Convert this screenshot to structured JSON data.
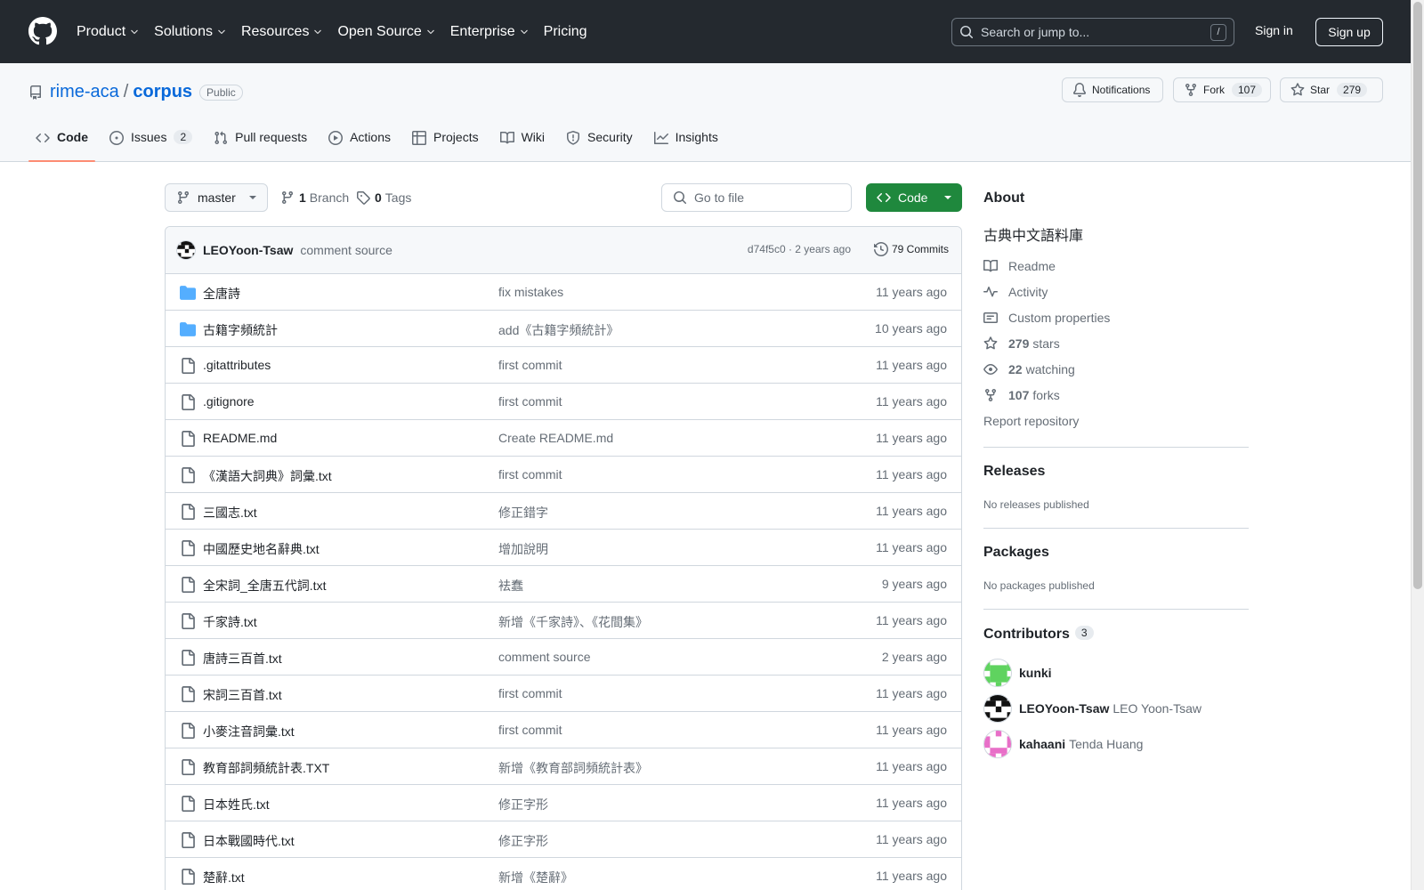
{
  "header": {
    "nav": [
      "Product",
      "Solutions",
      "Resources",
      "Open Source",
      "Enterprise",
      "Pricing"
    ],
    "search_placeholder": "Search or jump to...",
    "search_hint": "/",
    "signin": "Sign in",
    "signup": "Sign up"
  },
  "repo": {
    "owner": "rime-aca",
    "separator": "/",
    "name": "corpus",
    "visibility": "Public",
    "notifications": "Notifications",
    "fork_label": "Fork",
    "fork_count": "107",
    "star_label": "Star",
    "star_count": "279"
  },
  "tabs": [
    {
      "label": "Code",
      "icon": "code-icon"
    },
    {
      "label": "Issues",
      "icon": "issue-icon",
      "count": "2"
    },
    {
      "label": "Pull requests",
      "icon": "pull-request-icon"
    },
    {
      "label": "Actions",
      "icon": "play-icon"
    },
    {
      "label": "Projects",
      "icon": "table-icon"
    },
    {
      "label": "Wiki",
      "icon": "book-icon"
    },
    {
      "label": "Security",
      "icon": "shield-icon"
    },
    {
      "label": "Insights",
      "icon": "graph-icon"
    }
  ],
  "toolbar": {
    "branch": "master",
    "branch_count": "1",
    "branch_label": "Branch",
    "tag_count": "0",
    "tag_label": "Tags",
    "goto_placeholder": "Go to file",
    "code_button": "Code"
  },
  "latest_commit": {
    "author": "LEOYoon-Tsaw",
    "message": "comment source",
    "sha_age": "d74f5c0 · 2 years ago",
    "commits": "79 Commits"
  },
  "files": [
    {
      "type": "dir",
      "name": "全唐詩",
      "message": "fix mistakes",
      "age": "11 years ago"
    },
    {
      "type": "dir",
      "name": "古籍字頻統計",
      "message": "add《古籍字頻統計》",
      "age": "10 years ago"
    },
    {
      "type": "file",
      "name": ".gitattributes",
      "message": "first commit",
      "age": "11 years ago"
    },
    {
      "type": "file",
      "name": ".gitignore",
      "message": "first commit",
      "age": "11 years ago"
    },
    {
      "type": "file",
      "name": "README.md",
      "message": "Create README.md",
      "age": "11 years ago"
    },
    {
      "type": "file",
      "name": "《漢語大詞典》詞彙.txt",
      "message": "first commit",
      "age": "11 years ago"
    },
    {
      "type": "file",
      "name": "三國志.txt",
      "message": "修正錯字",
      "age": "11 years ago"
    },
    {
      "type": "file",
      "name": "中國歷史地名辭典.txt",
      "message": "增加說明",
      "age": "11 years ago"
    },
    {
      "type": "file",
      "name": "全宋詞_全唐五代詞.txt",
      "message": "袪蠢",
      "age": "9 years ago"
    },
    {
      "type": "file",
      "name": "千家詩.txt",
      "message": "新增《千家詩》、《花間集》",
      "age": "11 years ago"
    },
    {
      "type": "file",
      "name": "唐詩三百首.txt",
      "message": "comment source",
      "age": "2 years ago"
    },
    {
      "type": "file",
      "name": "宋詞三百首.txt",
      "message": "first commit",
      "age": "11 years ago"
    },
    {
      "type": "file",
      "name": "小麥注音詞彙.txt",
      "message": "first commit",
      "age": "11 years ago"
    },
    {
      "type": "file",
      "name": "教育部詞頻統計表.TXT",
      "message": "新增《教育部詞頻統計表》",
      "age": "11 years ago"
    },
    {
      "type": "file",
      "name": "日本姓氏.txt",
      "message": "修正字形",
      "age": "11 years ago"
    },
    {
      "type": "file",
      "name": "日本戰國時代.txt",
      "message": "修正字形",
      "age": "11 years ago"
    },
    {
      "type": "file",
      "name": "楚辭.txt",
      "message": "新增《楚辭》",
      "age": "11 years ago"
    }
  ],
  "about": {
    "title": "About",
    "description": "古典中文語料庫",
    "readme": "Readme",
    "activity": "Activity",
    "custom_properties": "Custom properties",
    "stars_count": "279",
    "stars_label": "stars",
    "watching_count": "22",
    "watching_label": "watching",
    "forks_count": "107",
    "forks_label": "forks",
    "report": "Report repository"
  },
  "releases": {
    "title": "Releases",
    "empty": "No releases published"
  },
  "packages": {
    "title": "Packages",
    "empty": "No packages published"
  },
  "contributors": {
    "title": "Contributors",
    "count": "3",
    "people": [
      {
        "login": "kunki",
        "name": "",
        "color": "#5fd35f"
      },
      {
        "login": "LEOYoon-Tsaw",
        "name": "LEO Yoon-Tsaw",
        "color": "#111111"
      },
      {
        "login": "kahaani",
        "name": "Tenda Huang",
        "color": "#e86fc8"
      }
    ]
  },
  "colors": {
    "header_bg": "#24292f",
    "link": "#0969da",
    "primary_button": "#1f883d",
    "tab_underline": "#fd8c73",
    "folder_icon": "#54aeff"
  }
}
